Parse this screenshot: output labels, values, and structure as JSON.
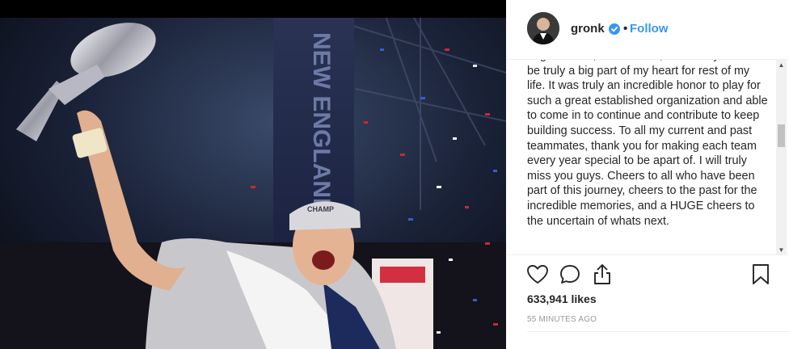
{
  "post": {
    "photo_description_icon": "trophy-celebration-photo",
    "banner_text": "NEW ENGLAND PATRIOTS",
    "cap_text": "CHAMP"
  },
  "header": {
    "username": "gronk",
    "verified_icon": "verified-check-icon",
    "separator": "•",
    "follow_label": "Follow"
  },
  "caption": {
    "text": "Organization, Pats Nation, and all my fans will be truly a big part of my heart for rest of my life. It was truly an incredible honor to play for such a great established organization and able to come in to continue and contribute to keep building success. To all my current and past teammates, thank you for making each team every year special to be apart of. I will truly miss you guys. Cheers to all who have been part of this journey, cheers to the past for the incredible memories, and a HUGE cheers to the uncertain of whats next."
  },
  "actions": {
    "like_icon": "heart-icon",
    "comment_icon": "comment-icon",
    "share_icon": "share-icon",
    "save_icon": "bookmark-icon"
  },
  "stats": {
    "likes": "633,941 likes",
    "posted": "55 MINUTES AGO"
  },
  "colors": {
    "link": "#3897f0",
    "text": "#262626",
    "muted": "#999999",
    "divider": "#efefef"
  }
}
